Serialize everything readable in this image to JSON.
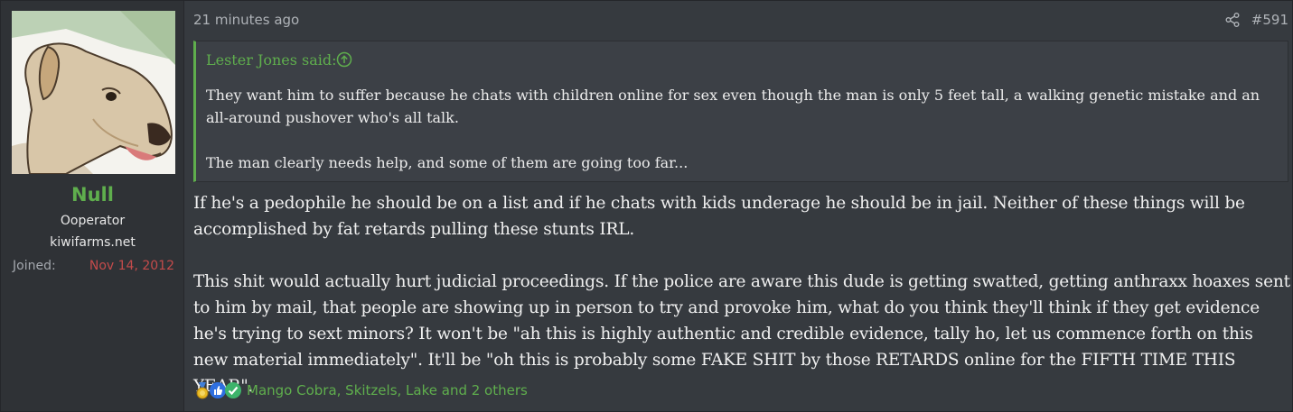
{
  "user": {
    "name": "Null",
    "title": "Ooperator",
    "banner": "kiwifarms.net",
    "joined_label": "Joined:",
    "joined_date": "Nov 14, 2012",
    "avatar_icon": "dog-avatar"
  },
  "post": {
    "timestamp": "21 minutes ago",
    "number": "#591",
    "share_icon": "share-icon",
    "quote": {
      "author_line": "Lester Jones said:",
      "paragraphs": [
        "They want him to suffer because he chats with children online for sex even though the man is only 5 feet tall, a walking genetic mistake and an all-around pushover who's all talk.",
        "The man clearly needs help, and some of them are going too far..."
      ]
    },
    "message": {
      "paragraphs": [
        "If he's a pedophile he should be on a list and if he chats with kids underage he should be in jail. Neither of these things will be accomplished by fat retards pulling these stunts IRL.",
        "This shit would actually hurt judicial proceedings. If the police are aware this dude is getting swatted, getting anthraxx hoaxes sent to him by mail, that people are showing up in person to try and provoke him, what do you think they'll think if they get evidence he's trying to sext minors? It won't be \"ah this is highly authentic and credible evidence, tally ho, let us commence forth on this new material immediately\". It'll be \"oh this is probably some FAKE SHIT by those RETARDS online for the FIFTH TIME THIS YEAR\"."
      ]
    },
    "reactions": {
      "icons": [
        "medal-icon",
        "like-icon",
        "check-icon"
      ],
      "text": "Mango Cobra, Skitzels, Lake and 2 others"
    }
  },
  "colors": {
    "accent": "#5fae4d",
    "joined_date": "#c44b4b",
    "background": "#363a3f",
    "sidebar": "#2f3236",
    "quote_bg": "#3c4046"
  }
}
